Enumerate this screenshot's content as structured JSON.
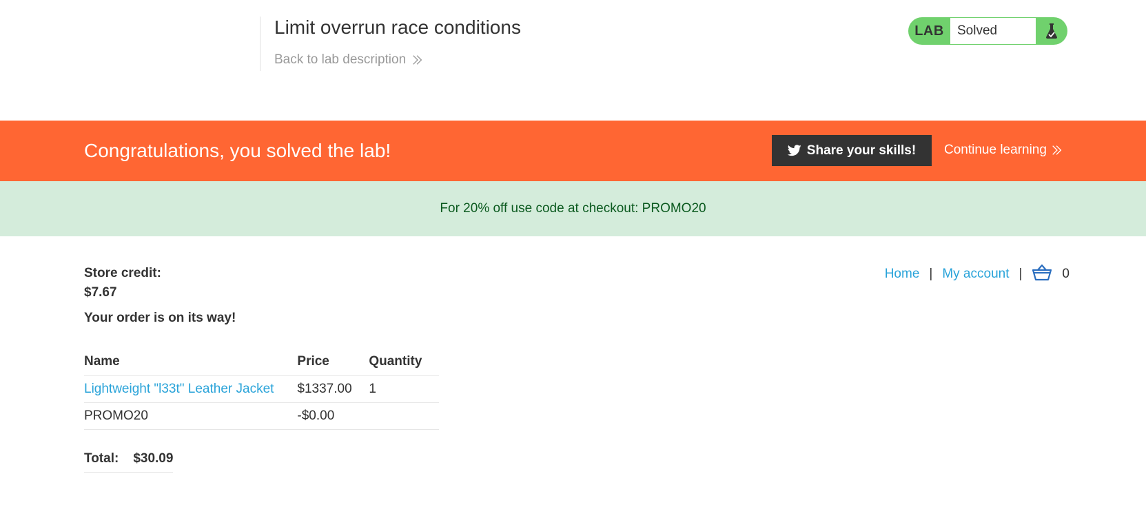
{
  "lab": {
    "title": "Limit overrun race conditions",
    "back_label": "Back to lab description",
    "tag": "LAB",
    "status": "Solved"
  },
  "congrats": {
    "message": "Congratulations, you solved the lab!",
    "share_label": "Share your skills!",
    "continue_label": "Continue learning"
  },
  "promo": {
    "text": "For 20% off use code at checkout: PROMO20"
  },
  "nav": {
    "home": "Home",
    "separator": "|",
    "my_account": "My account",
    "cart_count": "0"
  },
  "account": {
    "store_credit_label": "Store credit:",
    "store_credit_value": "$7.67"
  },
  "order": {
    "status": "Your order is on its way!",
    "columns": [
      "Name",
      "Price",
      "Quantity"
    ],
    "rows": [
      {
        "name": "Lightweight \"l33t\" Leather Jacket",
        "price": "$1337.00",
        "quantity": "1"
      },
      {
        "name": "PROMO20",
        "price": "-$0.00",
        "quantity": ""
      }
    ],
    "total_label": "Total:",
    "total_value": "$30.09"
  },
  "colors": {
    "banner": "#ff6633",
    "promo_bg": "#d4ecdb",
    "promo_text": "#0b5a1f",
    "link": "#29a3d9",
    "solved_green": "#70d16d"
  },
  "icons": {
    "back": "double-chevron-right-icon",
    "flask": "flask-icon",
    "share": "twitter-icon",
    "cart": "basket-icon"
  }
}
